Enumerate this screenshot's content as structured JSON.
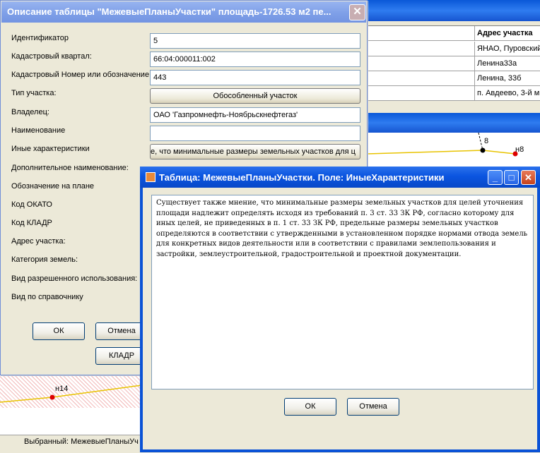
{
  "background": {
    "grid_header": "Адрес участка",
    "grid_rows": [
      "ЯНАО, Пуровский",
      "Ленина33а",
      "Ленина, 33б",
      "п. Авдеево, 3-й м"
    ],
    "map_labels": [
      "8",
      "н8",
      "н14"
    ],
    "status_text": "Выбранный: МежевыеПланыУч"
  },
  "dialog1": {
    "title": "Описание таблицы \"МежевыеПланыУчастки\"  площадь-1726.53 м2   пе...",
    "close_glyph": "✕",
    "fields": [
      {
        "label": "Идентификатор",
        "value": "5",
        "kind": "input"
      },
      {
        "label": "Кадастровый квартал:",
        "value": "66:04:000011:002",
        "kind": "input"
      },
      {
        "label": "Кадастровый Номер или обозначение",
        "value": "443",
        "kind": "input"
      },
      {
        "label": "Тип участка:",
        "value": "Обособленный участок",
        "kind": "button"
      },
      {
        "label": "Владелец:",
        "value": "ОАО 'Газпромнефть-Ноябрьскнефтегаз'",
        "kind": "input"
      },
      {
        "label": "Наименование",
        "value": "",
        "kind": "input"
      },
      {
        "label": "Иные характеристики",
        "value": "е, что минимальные размеры земельных участков для ц",
        "kind": "button"
      },
      {
        "label": "Дополнительное наименование:",
        "value": "",
        "kind": "hidden"
      },
      {
        "label": "Обозначение на плане",
        "value": "",
        "kind": "hidden"
      },
      {
        "label": "Код ОКАТО",
        "value": "",
        "kind": "hidden"
      },
      {
        "label": "Код КЛАДР",
        "value": "",
        "kind": "hidden"
      },
      {
        "label": "Адрес участка:",
        "value": "",
        "kind": "hidden"
      },
      {
        "label": "Категория земель:",
        "value": "",
        "kind": "hidden"
      },
      {
        "label": "Вид разрешенного использования:",
        "value": "",
        "kind": "hidden"
      },
      {
        "label": "Вид по справочнику",
        "value": "",
        "kind": "hidden"
      }
    ],
    "ok_label": "ОК",
    "cancel_label": "Отмена",
    "kladr_label": "КЛАДР"
  },
  "dialog2": {
    "title": "Таблица: МежевыеПланыУчастки. Поле: ИныеХарактеристики",
    "minimize_glyph": "_",
    "maximize_glyph": "□",
    "close_glyph": "✕",
    "memo_text": "Существует также мнение, что минимальные размеры земельных участков для целей уточнения площади надлежит определять исходя из требований п. 3 ст. 33 ЗК РФ, согласно которому для иных целей, не приведенных в п. 1 ст. 33 ЗК РФ, предельные размеры земельных участков определяются в соответствии с утвержденными в установленном порядке нормами отвода земель для конкретных видов деятельности или в соответствии с правилами землепользования и застройки, землеустроительной, градостроительной и проектной документации.",
    "ok_label": "ОК",
    "cancel_label": "Отмена"
  }
}
